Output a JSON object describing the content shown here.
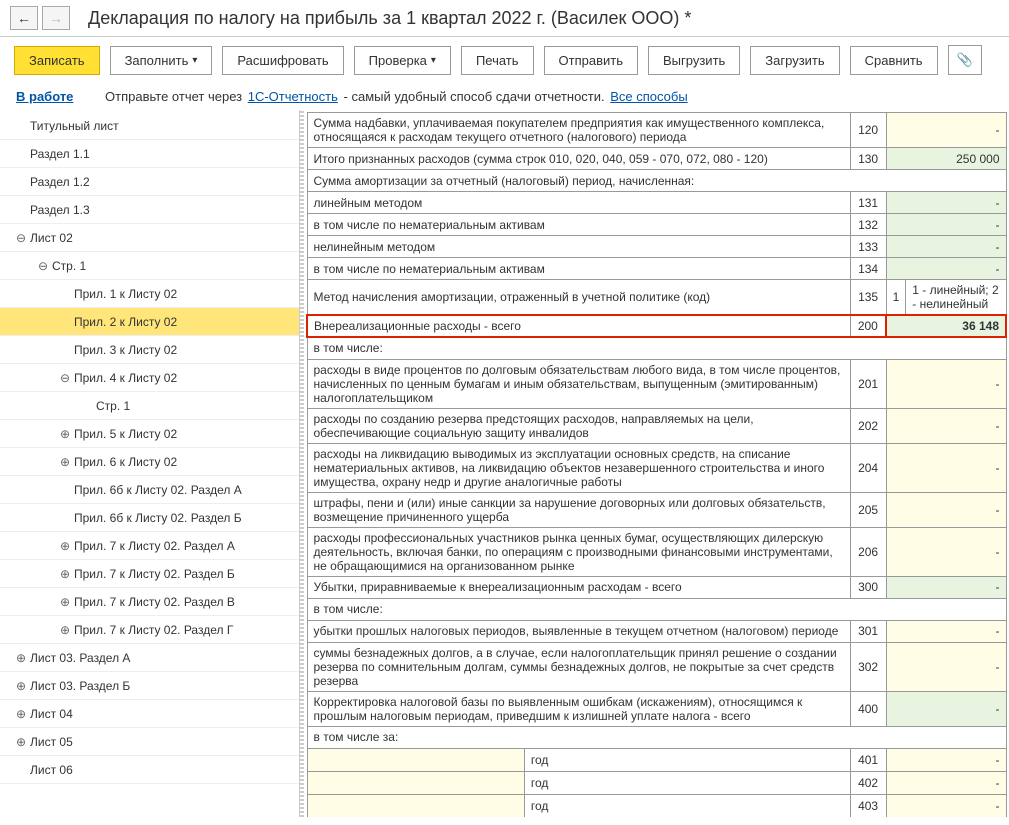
{
  "header": {
    "title": "Декларация по налогу на прибыль за 1 квартал 2022 г. (Василек ООО) *"
  },
  "toolbar": {
    "write": "Записать",
    "fill": "Заполнить",
    "decode": "Расшифровать",
    "check": "Проверка",
    "print": "Печать",
    "send": "Отправить",
    "export": "Выгрузить",
    "import": "Загрузить",
    "compare": "Сравнить"
  },
  "status": {
    "label": "В работе",
    "text1": "Отправьте отчет через ",
    "link1": "1С-Отчетность",
    "text2": " - самый удобный способ сдачи отчетности. ",
    "link2": "Все способы"
  },
  "tree": [
    {
      "label": "Титульный лист",
      "depth": 0,
      "exp": ""
    },
    {
      "label": "Раздел 1.1",
      "depth": 0,
      "exp": ""
    },
    {
      "label": "Раздел 1.2",
      "depth": 0,
      "exp": ""
    },
    {
      "label": "Раздел 1.3",
      "depth": 0,
      "exp": ""
    },
    {
      "label": "Лист 02",
      "depth": 0,
      "exp": "minus"
    },
    {
      "label": "Стр. 1",
      "depth": 1,
      "exp": "minus"
    },
    {
      "label": "Прил. 1 к Листу 02",
      "depth": 2,
      "exp": ""
    },
    {
      "label": "Прил. 2 к Листу 02",
      "depth": 2,
      "exp": "",
      "selected": true
    },
    {
      "label": "Прил. 3 к Листу 02",
      "depth": 2,
      "exp": ""
    },
    {
      "label": "Прил. 4 к Листу 02",
      "depth": 2,
      "exp": "minus"
    },
    {
      "label": "Стр. 1",
      "depth": 3,
      "exp": ""
    },
    {
      "label": "Прил. 5 к Листу 02",
      "depth": 2,
      "exp": "plus"
    },
    {
      "label": "Прил. 6 к Листу 02",
      "depth": 2,
      "exp": "plus"
    },
    {
      "label": "Прил. 6б к Листу 02. Раздел А",
      "depth": 2,
      "exp": ""
    },
    {
      "label": "Прил. 6б к Листу 02. Раздел Б",
      "depth": 2,
      "exp": ""
    },
    {
      "label": "Прил. 7 к Листу 02. Раздел А",
      "depth": 2,
      "exp": "plus"
    },
    {
      "label": "Прил. 7 к Листу 02. Раздел Б",
      "depth": 2,
      "exp": "plus"
    },
    {
      "label": "Прил. 7 к Листу 02. Раздел В",
      "depth": 2,
      "exp": "plus"
    },
    {
      "label": "Прил. 7 к Листу 02. Раздел Г",
      "depth": 2,
      "exp": "plus"
    },
    {
      "label": "Лист 03. Раздел А",
      "depth": 0,
      "exp": "plus"
    },
    {
      "label": "Лист 03. Раздел Б",
      "depth": 0,
      "exp": "plus"
    },
    {
      "label": "Лист 04",
      "depth": 0,
      "exp": "plus"
    },
    {
      "label": "Лист 05",
      "depth": 0,
      "exp": "plus"
    },
    {
      "label": "Лист 06",
      "depth": 0,
      "exp": ""
    }
  ],
  "rows": {
    "r120d": "Сумма надбавки, уплачиваемая покупателем предприятия как имущественного комплекса, относящаяся к расходам текущего отчетного (налогового) периода",
    "r120c": "120",
    "r130d": "Итого признанных расходов (сумма строк 010, 020, 040, 059 - 070, 072, 080 - 120)",
    "r130c": "130",
    "r130v": "250 000",
    "rAmort": "Сумма амортизации за отчетный (налоговый) период, начисленная:",
    "r131d": "линейным методом",
    "r131c": "131",
    "r132d": "в том числе по нематериальным активам",
    "r132c": "132",
    "r133d": "нелинейным методом",
    "r133c": "133",
    "r134d": "в том числе по нематериальным активам",
    "r134c": "134",
    "r135d": "Метод начисления амортизации, отраженный в учетной политике (код)",
    "r135c": "135",
    "r135m": "1",
    "r135hint": "1 - линейный; 2 - нелинейный",
    "r200d": "Внереализационные расходы - всего",
    "r200c": "200",
    "r200v": "36 148",
    "rIncl": "в том числе:",
    "r201d": "расходы в виде процентов по долговым обязательствам любого вида, в том числе процентов, начисленных по ценным бумагам и иным обязательствам, выпущенным (эмитированным) налогоплательщиком",
    "r201c": "201",
    "r202d": "расходы по созданию резерва предстоящих расходов, направляемых на цели, обеспечивающие социальную защиту инвалидов",
    "r202c": "202",
    "r204d": "расходы на ликвидацию выводимых из эксплуатации основных средств, на списание нематериальных активов, на ликвидацию объектов незавершенного строительства и иного имущества, охрану недр и другие аналогичные работы",
    "r204c": "204",
    "r205d": "штрафы, пени и (или) иные санкции за нарушение договорных или долговых обязательств, возмещение причиненного ущерба",
    "r205c": "205",
    "r206d": "расходы профессиональных участников рынка ценных бумаг, осуществляющих дилерскую деятельность, включая банки, по операциям с производными финансовыми инструментами, не обращающимися на организованном рынке",
    "r206c": "206",
    "r300d": "Убытки, приравниваемые к внереализационным расходам - всего",
    "r300c": "300",
    "rIncl2": "в том числе:",
    "r301d": "убытки прошлых налоговых периодов, выявленные в текущем отчетном (налоговом) периоде",
    "r301c": "301",
    "r302d": "суммы безнадежных долгов, а в случае, если налогоплательщик принял решение о создании резерва по сомнительным долгам, суммы безнадежных долгов, не покрытые за счет средств резерва",
    "r302c": "302",
    "r400d": "Корректировка налоговой базы по выявленным ошибкам (искажениям), относящимся к прошлым налоговым периодам, приведшим к излишней уплате налога - всего",
    "r400c": "400",
    "rIncl3": "в том числе за:",
    "year": "год",
    "r401c": "401",
    "r402c": "402",
    "r403c": "403",
    "dash": "-"
  }
}
